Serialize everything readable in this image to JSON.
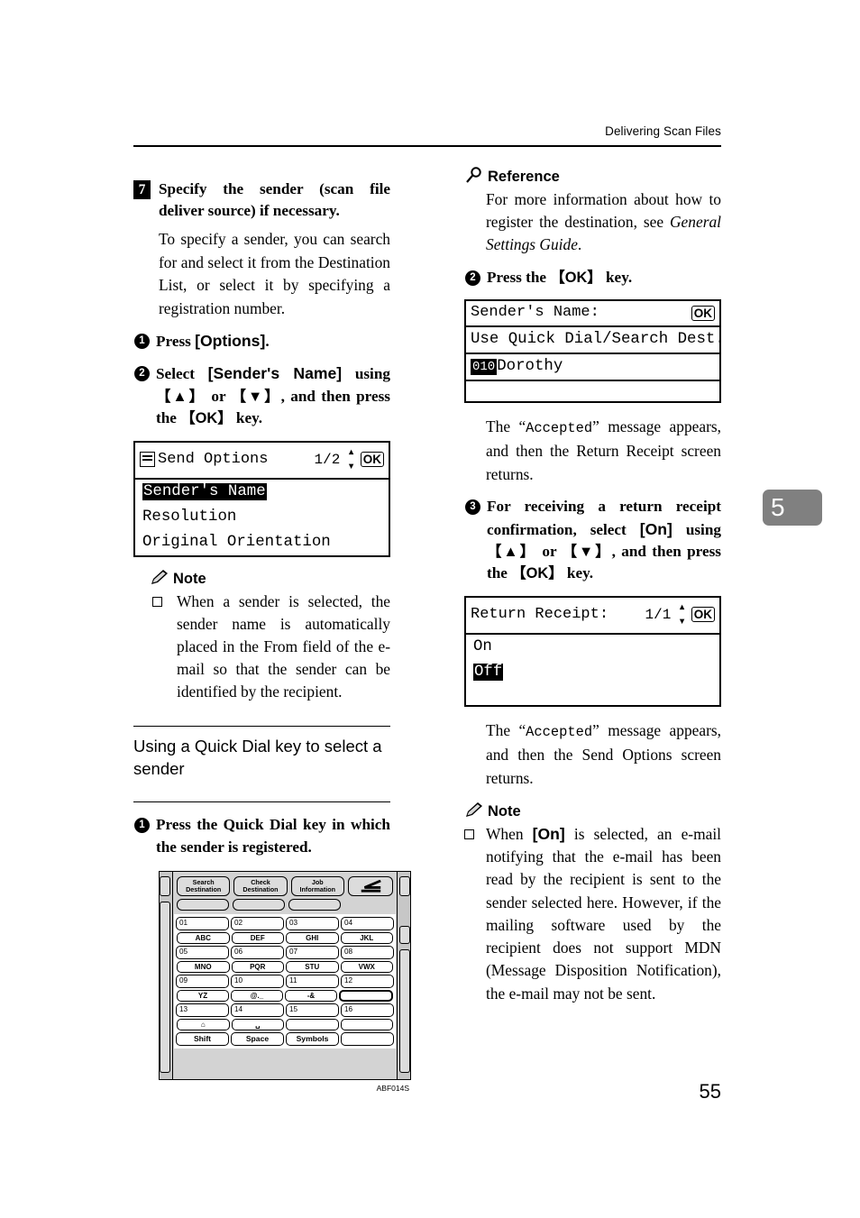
{
  "header": {
    "running_head": "Delivering Scan Files"
  },
  "page_number": "55",
  "chapter_tab": {
    "number": "5",
    "color": "#808080"
  },
  "left_column": {
    "step7": {
      "marker": "7",
      "heading": "Specify the sender (scan file deliver source) if necessary.",
      "body": "To specify a sender, you can search for and select it from the Destination List, or select it by specifying a registration number."
    },
    "substep1": {
      "marker": "1",
      "text_before": "Press ",
      "key": "[Options]",
      "text_after": "."
    },
    "substep2": {
      "marker": "2",
      "line1_a": "Select ",
      "line1_key": "[Sender's Name]",
      "line1_b": " using",
      "line2_key1": "【▲】",
      "line2_mid": " or ",
      "line2_key2": "【▼】",
      "line2_b": ", and then press the",
      "line3_key": "【OK】",
      "line3_b": " key."
    },
    "lcd_send_options": {
      "title": "Send Options",
      "page_count": "1/2",
      "ok_label": "OK",
      "rows": [
        {
          "text": "Sender's Name",
          "highlighted": true
        },
        {
          "text": "Resolution",
          "highlighted": false
        },
        {
          "text": "Original Orientation",
          "highlighted": false
        }
      ]
    },
    "note": {
      "title": "Note",
      "icon": "pencil-icon",
      "bullet": "When a sender is selected, the sender name is automatically placed in the From field of the e-mail so that the sender can be identified by the recipient."
    },
    "section": {
      "heading": "Using a Quick Dial key to select a sender"
    },
    "quick_dial_step": {
      "marker": "1",
      "text": "Press the Quick Dial key in which the sender is registered."
    },
    "keypad_figure": {
      "caption": "ABF014S",
      "function_buttons": [
        "Search\nDestination",
        "Check\nDestination",
        "Job\nInformation"
      ],
      "start_icon": "start-key-icon",
      "number_rows": [
        [
          "01",
          "02",
          "03",
          "04"
        ],
        [
          "05",
          "06",
          "07",
          "08"
        ],
        [
          "09",
          "10",
          "11",
          "12"
        ],
        [
          "13",
          "14",
          "15",
          "16"
        ]
      ],
      "letter_rows": [
        [
          "ABC",
          "DEF",
          "GHI",
          "JKL"
        ],
        [
          "MNO",
          "PQR",
          "STU",
          "VWX"
        ],
        [
          "YZ",
          "@._",
          "-&",
          ""
        ],
        [
          "⌂",
          "␣",
          "",
          ""
        ]
      ],
      "letter_row_selected": {
        "row": 2,
        "index": 3
      },
      "bottom_row": [
        "Shift",
        "Space",
        "Symbols",
        ""
      ]
    }
  },
  "right_column": {
    "reference": {
      "title": "Reference",
      "icon": "magnifier-icon",
      "body_a": "For more information about how to register the destination, see ",
      "body_italic": "General Settings Guide",
      "body_b": "."
    },
    "substep2": {
      "marker": "2",
      "text_a": "Press the ",
      "key": "【OK】",
      "text_b": " key."
    },
    "lcd_senders_name": {
      "title": "Sender's Name:",
      "ok_label": "OK",
      "prompt": "Use Quick Dial/Search Dest.",
      "entry_id": "010",
      "entry_name": "Dorothy"
    },
    "para_accepted_1": {
      "a": "The “",
      "mono": "Accepted",
      "b": "” message appears, and then the Return Receipt screen returns."
    },
    "substep3": {
      "marker": "3",
      "l1": "For receiving a return receipt",
      "l2_a": "confirmation, select ",
      "l2_key": "[On]",
      "l2_b": " using",
      "l3_key1": "【▲】",
      "l3_mid": " or ",
      "l3_key2": "【▼】",
      "l3_b": ", and then press the",
      "l4_key": "【OK】",
      "l4_b": " key."
    },
    "lcd_return_receipt": {
      "title": "Return Receipt:",
      "page_count": "1/1",
      "ok_label": "OK",
      "rows": [
        {
          "text": "On",
          "highlighted": false
        },
        {
          "text": "Off",
          "highlighted": true
        }
      ]
    },
    "para_accepted_2": {
      "a": "The “",
      "mono": "Accepted",
      "b": "” message appears, and then the Send Options screen returns."
    },
    "note": {
      "title": "Note",
      "icon": "pencil-icon",
      "bullet_a": "When ",
      "bullet_key": "[On]",
      "bullet_b": " is selected, an e-mail notifying that the e-mail has been read by the recipient is sent to the sender selected here. However, if the mailing software used by the recipient does not support MDN (Message Disposition Notification), the e-mail may not be sent."
    }
  }
}
